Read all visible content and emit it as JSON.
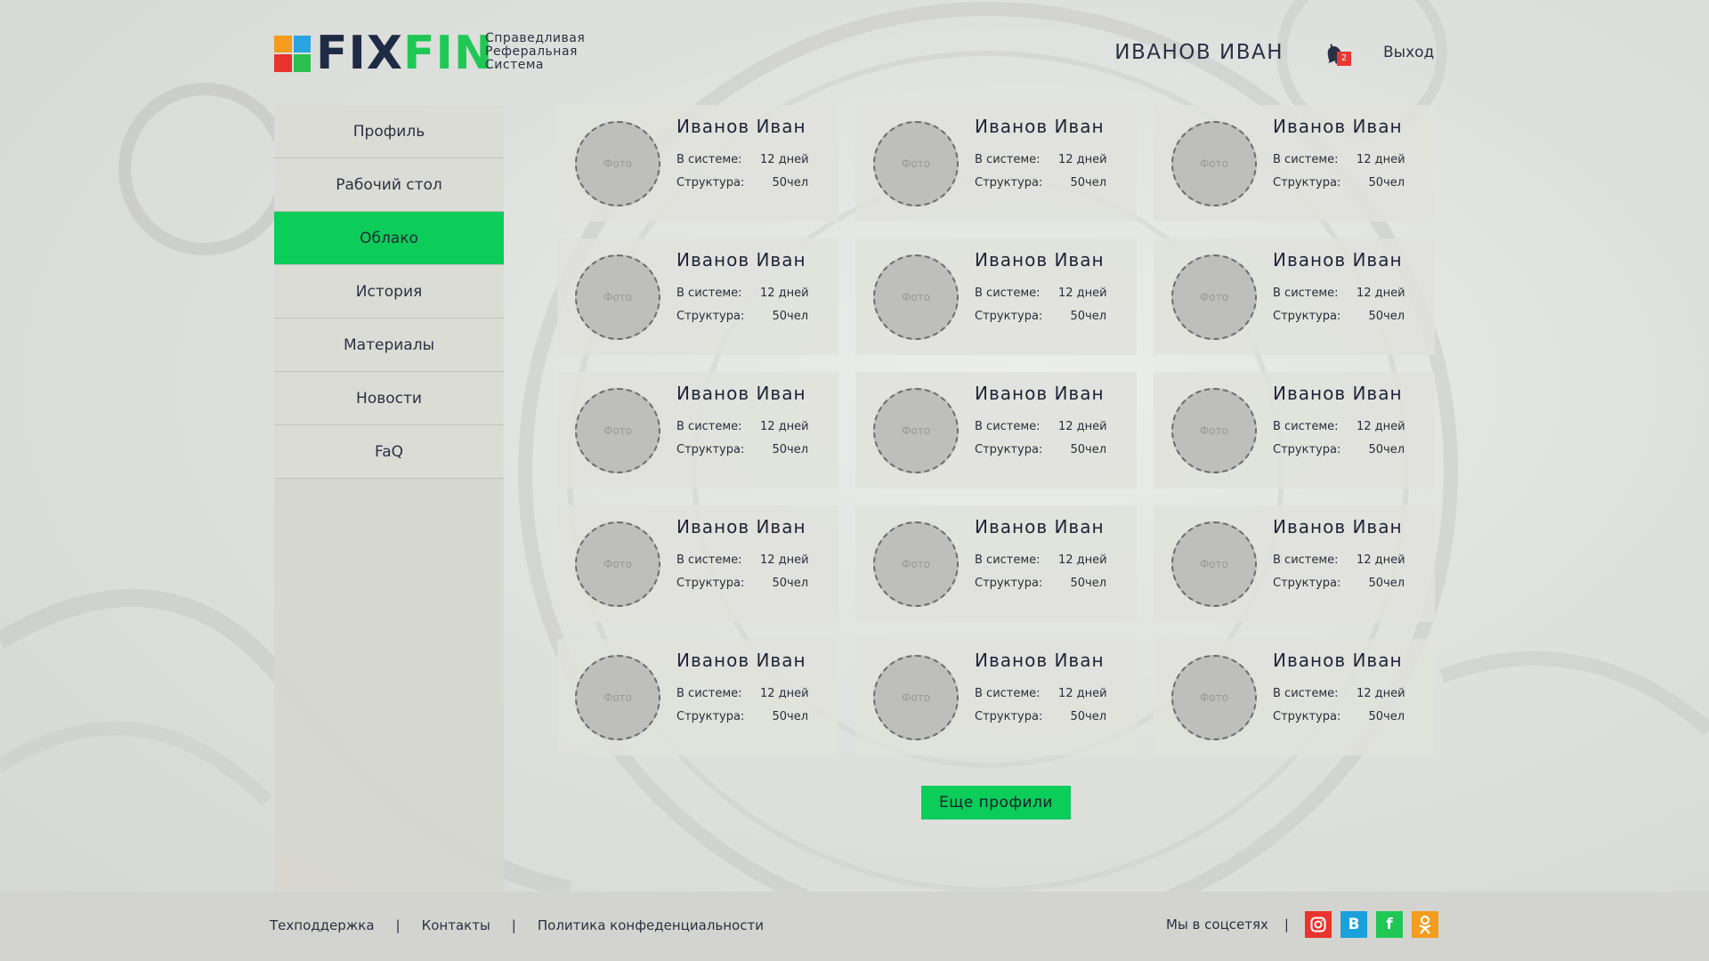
{
  "header": {
    "logo_fix": "FIX",
    "logo_fin": "FIN",
    "tagline": [
      "Справедливая",
      "Реферальная",
      "Система"
    ],
    "username": "ИВАНОВ ИВАН",
    "notification_count": "2",
    "logout_label": "Выход"
  },
  "sidebar": {
    "items": [
      {
        "label": "Профиль"
      },
      {
        "label": "Рабочий стол"
      },
      {
        "label": "Облако"
      },
      {
        "label": "История"
      },
      {
        "label": "Материалы"
      },
      {
        "label": "Новости"
      },
      {
        "label": "FaQ"
      }
    ],
    "active_index": 2
  },
  "profiles": [
    {
      "name": "Иванов Иван",
      "photo": "Фото",
      "in_system_label": "В системе:",
      "in_system": "12 дней",
      "structure_label": "Структура:",
      "structure": "50чел"
    },
    {
      "name": "Иванов Иван",
      "photo": "Фото",
      "in_system_label": "В системе:",
      "in_system": "12 дней",
      "structure_label": "Структура:",
      "structure": "50чел"
    },
    {
      "name": "Иванов Иван",
      "photo": "Фото",
      "in_system_label": "В системе:",
      "in_system": "12 дней",
      "structure_label": "Структура:",
      "structure": "50чел"
    },
    {
      "name": "Иванов Иван",
      "photo": "Фото",
      "in_system_label": "В системе:",
      "in_system": "12 дней",
      "structure_label": "Структура:",
      "structure": "50чел"
    },
    {
      "name": "Иванов Иван",
      "photo": "Фото",
      "in_system_label": "В системе:",
      "in_system": "12 дней",
      "structure_label": "Структура:",
      "structure": "50чел"
    },
    {
      "name": "Иванов Иван",
      "photo": "Фото",
      "in_system_label": "В системе:",
      "in_system": "12 дней",
      "structure_label": "Структура:",
      "structure": "50чел"
    },
    {
      "name": "Иванов Иван",
      "photo": "Фото",
      "in_system_label": "В системе:",
      "in_system": "12 дней",
      "structure_label": "Структура:",
      "structure": "50чел"
    },
    {
      "name": "Иванов Иван",
      "photo": "Фото",
      "in_system_label": "В системе:",
      "in_system": "12 дней",
      "structure_label": "Структура:",
      "structure": "50чел"
    },
    {
      "name": "Иванов Иван",
      "photo": "Фото",
      "in_system_label": "В системе:",
      "in_system": "12 дней",
      "structure_label": "Структура:",
      "structure": "50чел"
    },
    {
      "name": "Иванов Иван",
      "photo": "Фото",
      "in_system_label": "В системе:",
      "in_system": "12 дней",
      "structure_label": "Структура:",
      "structure": "50чел"
    },
    {
      "name": "Иванов Иван",
      "photo": "Фото",
      "in_system_label": "В системе:",
      "in_system": "12 дней",
      "structure_label": "Структура:",
      "structure": "50чел"
    },
    {
      "name": "Иванов Иван",
      "photo": "Фото",
      "in_system_label": "В системе:",
      "in_system": "12 дней",
      "structure_label": "Структура:",
      "structure": "50чел"
    },
    {
      "name": "Иванов Иван",
      "photo": "Фото",
      "in_system_label": "В системе:",
      "in_system": "12 дней",
      "structure_label": "Структура:",
      "structure": "50чел"
    },
    {
      "name": "Иванов Иван",
      "photo": "Фото",
      "in_system_label": "В системе:",
      "in_system": "12 дней",
      "structure_label": "Структура:",
      "structure": "50чел"
    },
    {
      "name": "Иванов Иван",
      "photo": "Фото",
      "in_system_label": "В системе:",
      "in_system": "12 дней",
      "structure_label": "Структура:",
      "structure": "50чел"
    }
  ],
  "more_button": "Еще профили",
  "footer": {
    "links": [
      "Техподдержка",
      "Контакты",
      "Политика конфеденциальности"
    ],
    "separator": "|",
    "social_label": "Мы в соцсетях",
    "social": [
      {
        "icon": "instagram-icon",
        "color": "#e8342c"
      },
      {
        "icon": "vk-icon",
        "color": "#1aa1dc",
        "glyph": "В"
      },
      {
        "icon": "facebook-icon",
        "color": "#1fc754",
        "glyph": "f"
      },
      {
        "icon": "odnoklassniki-icon",
        "color": "#f39c1e"
      }
    ]
  },
  "colors": {
    "accent_green": "#0ccc5a",
    "logo_dark": "#1f2a44",
    "badge_red": "#e53935"
  }
}
